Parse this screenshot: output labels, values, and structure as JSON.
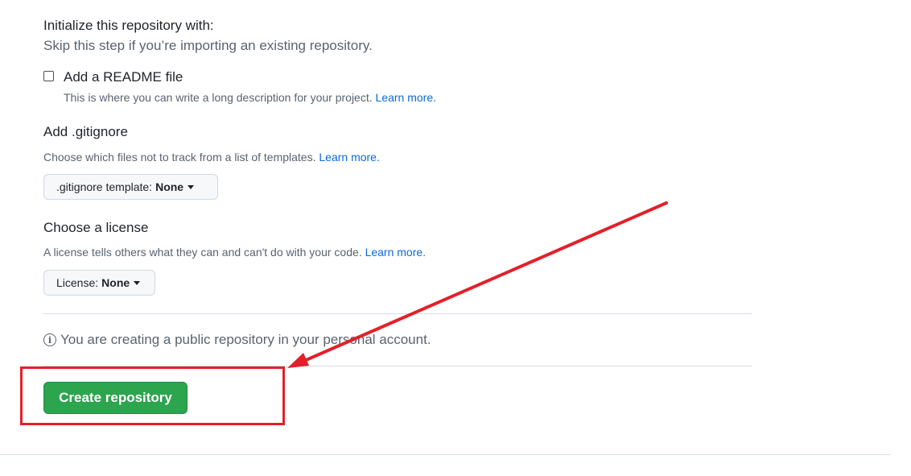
{
  "init": {
    "title": "Initialize this repository with:",
    "subtitle": "Skip this step if you’re importing an existing repository."
  },
  "readme": {
    "checked": false,
    "label": "Add a README file",
    "description": "This is where you can write a long description for your project.",
    "learn_more": "Learn more."
  },
  "gitignore": {
    "heading": "Add .gitignore",
    "description": "Choose which files not to track from a list of templates.",
    "learn_more": "Learn more.",
    "dropdown_label": ".gitignore template:",
    "dropdown_value": "None"
  },
  "license": {
    "heading": "Choose a license",
    "description": "A license tells others what they can and can't do with your code.",
    "learn_more": "Learn more.",
    "dropdown_label": "License:",
    "dropdown_value": "None"
  },
  "info": {
    "icon": "info-icon",
    "text": "You are creating a public repository in your personal account."
  },
  "create_button": {
    "label": "Create repository",
    "color": "#2da44e"
  },
  "annotation": {
    "color": "#e3202a"
  }
}
